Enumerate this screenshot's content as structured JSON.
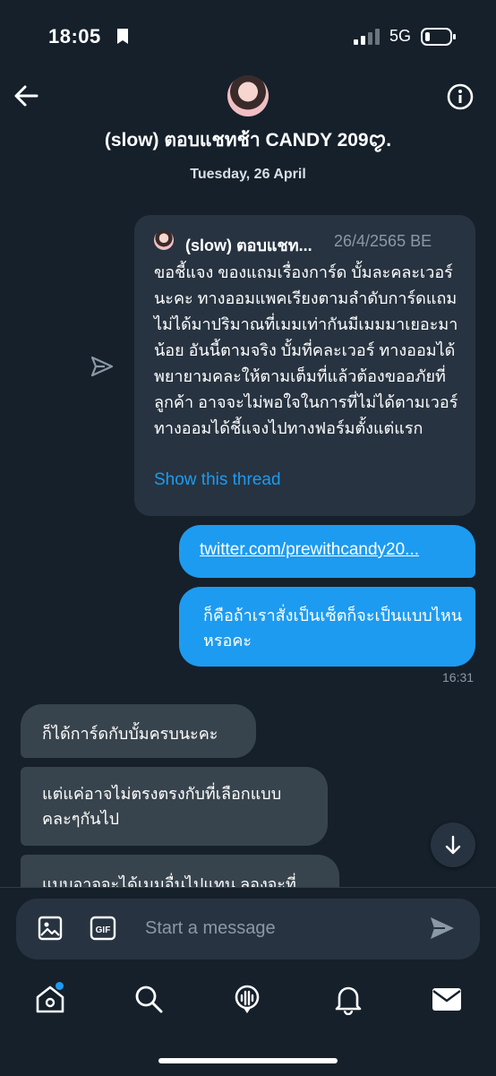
{
  "status_bar": {
    "time": "18:05",
    "network": "5G"
  },
  "header": {
    "title": "(slow) ตอบแชทช้า CANDY 209ꨄ︎.",
    "date": "Tuesday, 26 April"
  },
  "quoted_tweet": {
    "author": "(slow) ตอบแชท...",
    "date": "26/4/2565 BE",
    "text": "ขอชี้แจง ของแถมเรื่องการ์ด บั้มละคละเวอร์นะคะ ทางออมแพคเรียงตามลำดับการ์ดแถมไม่ได้มาปริมาณที่เมมเท่ากันมีเมมมาเยอะมาน้อย อันนี้ตามจริง บั้มที่คละเวอร์ ทางออมได้พยายามคละให้ตามเต็มที่แล้วต้องขออภัยที่ลูกค้า อาจจะไม่พอใจในการที่ไม่ได้ตามเวอร์ ทางออมได้ชี้แจงไปทางฟอร์มตั้งแต่แรก",
    "show_thread": "Show this thread"
  },
  "messages": {
    "out_link": "twitter.com/prewithcandy20...",
    "out_text": "ก็คือถ้าเราสั่งเป็นเซ็ตก็จะเป็นแบบไหนหรอคะ",
    "out_time": "16:31",
    "in1": "ก็ได้การ์ดกับบั้มครบนะคะ",
    "in2": "แต่แค่อาจไม่ตรงตรงกับที่เลือกแบบคละๆกันไป",
    "in3": "แบบอาจจะได้เมมอื่นไปแทน ลองจะที่"
  },
  "composer": {
    "placeholder": "Start a message",
    "gif_label": "GIF"
  },
  "colors": {
    "background": "#15202b",
    "accent": "#1d9bf0",
    "bubble_in": "#38444d",
    "card": "#273340"
  },
  "icons": {
    "status": [
      "bookmark-icon",
      "signal-icon",
      "battery-icon"
    ],
    "header": [
      "back-arrow-icon",
      "info-icon"
    ],
    "composer": [
      "image-icon",
      "gif-icon",
      "send-icon"
    ],
    "tabs": [
      "home-icon",
      "search-icon",
      "spaces-icon",
      "notifications-icon",
      "messages-icon"
    ]
  }
}
